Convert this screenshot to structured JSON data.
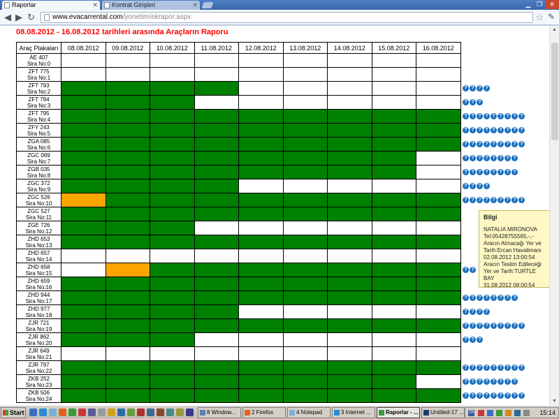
{
  "browser": {
    "tabs": [
      {
        "title": "Raporlar"
      },
      {
        "title": "Kontrat Girişleri"
      }
    ],
    "url_host": "www.evacarrental.com",
    "url_path": "/yonetim/ekrapor.aspx"
  },
  "report": {
    "title": "08.08.2012 - 16.08.2012 tarihleri arasında Araçların Raporu",
    "plate_header": "Araç Plakaları",
    "dates": [
      "08.08.2012",
      "09.08.2012",
      "10.08.2012",
      "11.08.2012",
      "12.08.2012",
      "13.08.2012",
      "14.08.2012",
      "15.08.2012",
      "16.08.2012"
    ],
    "rows": [
      {
        "plate": "AE 407",
        "seq": "Sira No:0",
        "cells": "wwwwwwwww",
        "icons": 0
      },
      {
        "plate": "ZFT 775",
        "seq": "Sira No:1",
        "cells": "wwwwwwwww",
        "icons": 0
      },
      {
        "plate": "ZFT 793",
        "seq": "Sira No:2",
        "cells": "ggggwwwww",
        "icons": 4
      },
      {
        "plate": "ZFT 794",
        "seq": "Sira No:3",
        "cells": "gggwwwwww",
        "icons": 3
      },
      {
        "plate": "ZFT 795",
        "seq": "Sira No:4",
        "cells": "ggggggggg",
        "icons": 9
      },
      {
        "plate": "ZFY 243",
        "seq": "Sira No:5",
        "cells": "ggggggggg",
        "icons": 9
      },
      {
        "plate": "ZGA 085",
        "seq": "Sira No:6",
        "cells": "ggggggggg",
        "icons": 9
      },
      {
        "plate": "ZGC 069",
        "seq": "Sira No:7",
        "cells": "ggggggggw",
        "icons": 8
      },
      {
        "plate": "ZGB 035",
        "seq": "Sira No:8",
        "cells": "ggggggggw",
        "icons": 8
      },
      {
        "plate": "ZGC 372",
        "seq": "Sira No:9",
        "cells": "ggggwwwww",
        "icons": 4
      },
      {
        "plate": "ZGC 526",
        "seq": "Sira No:10",
        "cells": "oggggggggg",
        "icons": 9
      },
      {
        "plate": "ZGC 527",
        "seq": "Sira No:11",
        "cells": "ggggggggg",
        "icons": 0
      },
      {
        "plate": "ZGE 726",
        "seq": "Sira No:12",
        "cells": "gggwwwwww",
        "icons": 0
      },
      {
        "plate": "ZHD 653",
        "seq": "Sira No:13",
        "cells": "ggggggggg",
        "icons": 0
      },
      {
        "plate": "ZHD 657",
        "seq": "Sira No:14",
        "cells": "wwwwwwwww",
        "icons": 0
      },
      {
        "plate": "ZHD 658",
        "seq": "Sira No:15",
        "cells": "wogggggggg",
        "icons": 2
      },
      {
        "plate": "ZHD 659",
        "seq": "Sira No:16",
        "cells": "ggggggggg",
        "icons": 0
      },
      {
        "plate": "ZHD 944",
        "seq": "Sira No:17",
        "cells": "ggggggggg",
        "icons": 8
      },
      {
        "plate": "ZHD 977",
        "seq": "Sira No:18",
        "cells": "ggggwwwww",
        "icons": 4
      },
      {
        "plate": "ZJR 721",
        "seq": "Sira No:19",
        "cells": "ggggggggg",
        "icons": 9
      },
      {
        "plate": "ZJR 862",
        "seq": "Sira No:20",
        "cells": "gggwwwwww",
        "icons": 3
      },
      {
        "plate": "ZJR 649",
        "seq": "Sira No:21",
        "cells": "wwwwwwwww",
        "icons": 0
      },
      {
        "plate": "ZJR 797",
        "seq": "Sira No:22",
        "cells": "ggggggggg",
        "icons": 9
      },
      {
        "plate": "ZKB 252",
        "seq": "Sira No:23",
        "cells": "ggggggggw",
        "icons": 8
      },
      {
        "plate": "ZKB 506",
        "seq": "Sira No:24",
        "cells": "ggggggggg",
        "icons": 9
      }
    ],
    "icon_glyph": "?"
  },
  "tooltip": {
    "title": "Bilgi",
    "lines": [
      "NATALIA MIRONOVA",
      "Tel:05428755565,-,-",
      "Aracın Alınacağı Yer ve",
      "Tarih:Ercan Havalimanı",
      "02.08.2012 13:00:54",
      "Aracın Teslim Edileceği",
      "Yer ve Tarih:TURTLE BAY",
      "31.08.2012 08:00:54"
    ]
  },
  "taskbar": {
    "start": "Start",
    "buttons": [
      {
        "label": "8 Window..."
      },
      {
        "label": "2 Firefox"
      },
      {
        "label": "4 Notepad"
      },
      {
        "label": "3 Internet ..."
      },
      {
        "label": "Raporlar - ..."
      },
      {
        "label": "Untitled-17 ..."
      }
    ],
    "clock": "15:14",
    "lang": "TR"
  },
  "colors": {
    "occupied": "#008000",
    "pending": "#ffa500",
    "free": "#ffffff",
    "title": "#ff0000"
  }
}
